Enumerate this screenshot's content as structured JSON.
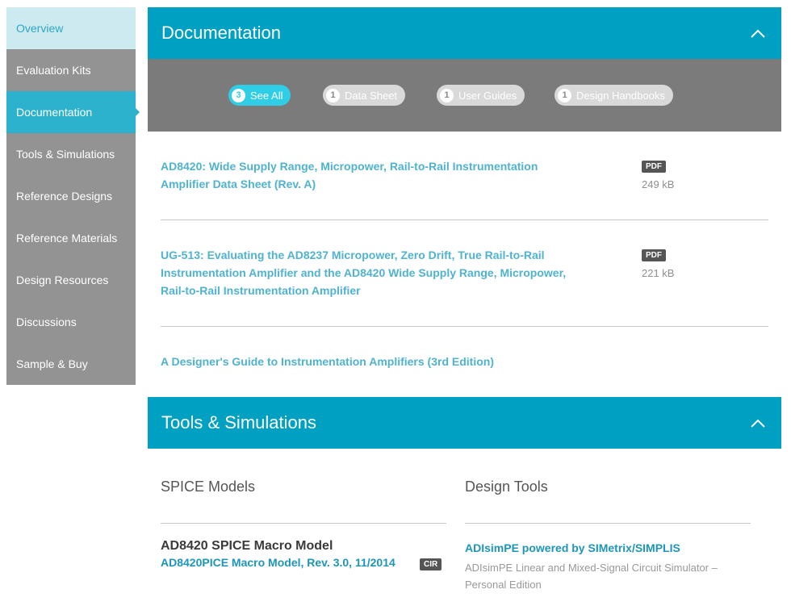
{
  "sidebar": {
    "items": [
      {
        "label": "Overview"
      },
      {
        "label": "Evaluation Kits"
      },
      {
        "label": "Documentation"
      },
      {
        "label": "Tools & Simulations"
      },
      {
        "label": "Reference Designs"
      },
      {
        "label": "Reference Materials"
      },
      {
        "label": "Design Resources"
      },
      {
        "label": "Discussions"
      },
      {
        "label": "Sample & Buy"
      }
    ]
  },
  "documentation": {
    "title": "Documentation",
    "filters": [
      {
        "count": "3",
        "label": "See All"
      },
      {
        "count": "1",
        "label": "Data Sheet"
      },
      {
        "count": "1",
        "label": "User Guides"
      },
      {
        "count": "1",
        "label": "Design Handbooks"
      }
    ],
    "docs": [
      {
        "title_l1": "AD8420: Wide Supply Range, Micropower, Rail-to-Rail Instrumentation",
        "title_l2": "Amplifier Data Sheet (Rev. A)",
        "type": "PDF",
        "size": "249 kB"
      },
      {
        "title_l1": "UG-513: Evaluating the AD8237 Micropower, Zero Drift, True Rail-to-Rail",
        "title_l2": "Instrumentation Amplifier and the AD8420 Wide Supply Range, Micropower,",
        "title_l3": "Rail-to-Rail Instrumentation Amplifier",
        "type": "PDF",
        "size": "221 kB"
      },
      {
        "title_l1": "A Designer's Guide to Instrumentation Amplifiers (3rd Edition)"
      }
    ]
  },
  "tools": {
    "title": "Tools & Simulations",
    "spice": {
      "heading": "SPICE Models",
      "model_title": "AD8420 SPICE Macro Model",
      "model_link": "AD8420PICE Macro Model, Rev. 3.0, 11/2014",
      "model_type": "CIR"
    },
    "design_tools": {
      "heading": "Design Tools",
      "tool_link": "ADIsimPE powered by SIMetrix/SIMPLIS",
      "tool_desc": "ADIsimPE Linear and Mixed-Signal Circuit Simulator – Personal Edition"
    }
  }
}
